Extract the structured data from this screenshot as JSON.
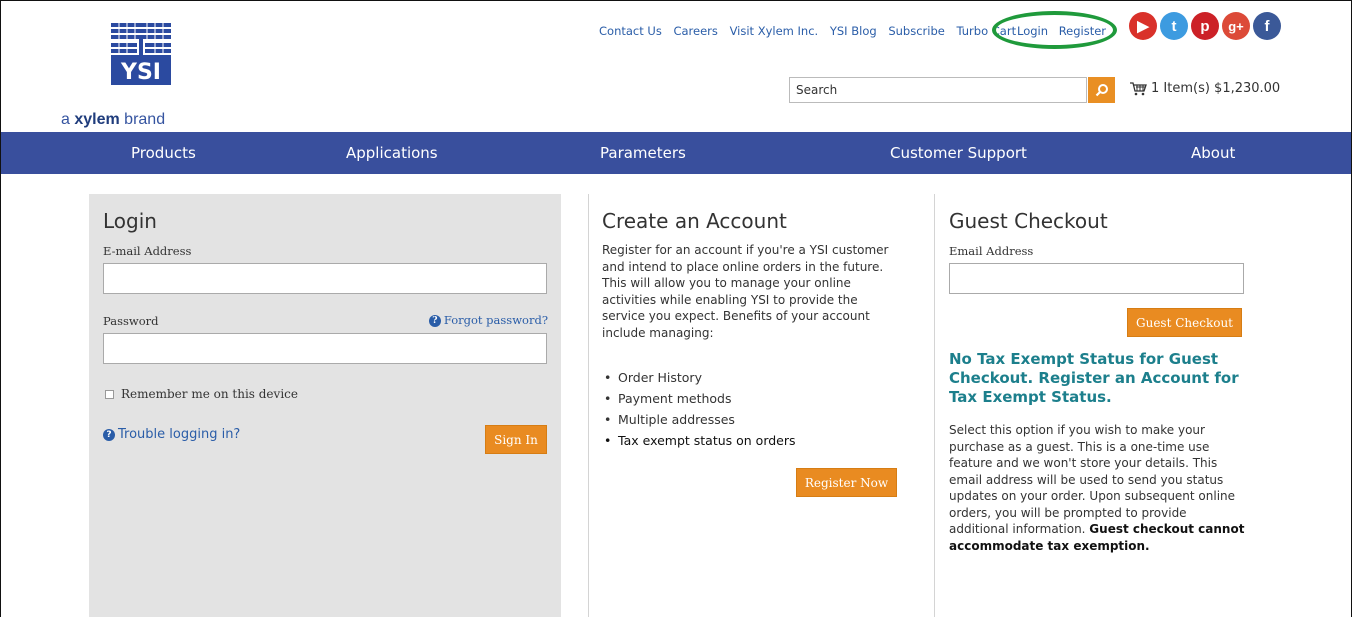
{
  "brand": {
    "logo_text": "YSI",
    "sub_prefix": "a ",
    "sub_bold": "xylem",
    "sub_suffix": " brand"
  },
  "top_links": [
    "Contact Us",
    "Careers",
    "Visit Xylem Inc.",
    "YSI Blog",
    "Subscribe",
    "Turbo Cart"
  ],
  "account_links": {
    "login": "Login",
    "register": "Register"
  },
  "social": [
    {
      "name": "youtube-icon",
      "glyph": "▶",
      "color": "#d9312a"
    },
    {
      "name": "twitter-icon",
      "glyph": "t",
      "color": "#3d9be0"
    },
    {
      "name": "pinterest-icon",
      "glyph": "p",
      "color": "#cc2127"
    },
    {
      "name": "google-plus-icon",
      "glyph": "g+",
      "color": "#dc4a38"
    },
    {
      "name": "facebook-icon",
      "glyph": "f",
      "color": "#3b5998"
    }
  ],
  "search": {
    "placeholder": "Search"
  },
  "cart": {
    "summary": "1 Item(s) $1,230.00"
  },
  "nav": [
    "Products",
    "Applications",
    "Parameters",
    "Customer Support",
    "About"
  ],
  "login": {
    "title": "Login",
    "email_label": "E-mail Address",
    "password_label": "Password",
    "forgot": "Forgot password?",
    "remember": "Remember me on this device",
    "trouble": "Trouble logging in?",
    "sign_in": "Sign In"
  },
  "create": {
    "title": "Create an Account",
    "intro": "Register for an account if you're a YSI customer and intend to place online orders in the future. This will allow you to manage your online activities while enabling YSI to provide the service you expect.  Benefits of your account include managing:",
    "benefits": [
      "Order History",
      "Payment methods",
      "Multiple addresses",
      "Tax exempt status on orders"
    ],
    "register_btn": "Register Now"
  },
  "guest": {
    "title": "Guest Checkout",
    "email_label": "Email Address",
    "checkout_btn": "Guest Checkout",
    "notice": "No Tax Exempt Status for Guest Checkout.  Register an Account for Tax Exempt Status.",
    "description": "Select this option if you wish to make your purchase as a guest. This is a one-time use feature and we won't store your details. This email address will be used to send you status updates on your order. Upon subsequent online orders, you will be prompted to provide additional information. ",
    "description_bold": "Guest checkout cannot accommodate tax exemption."
  }
}
